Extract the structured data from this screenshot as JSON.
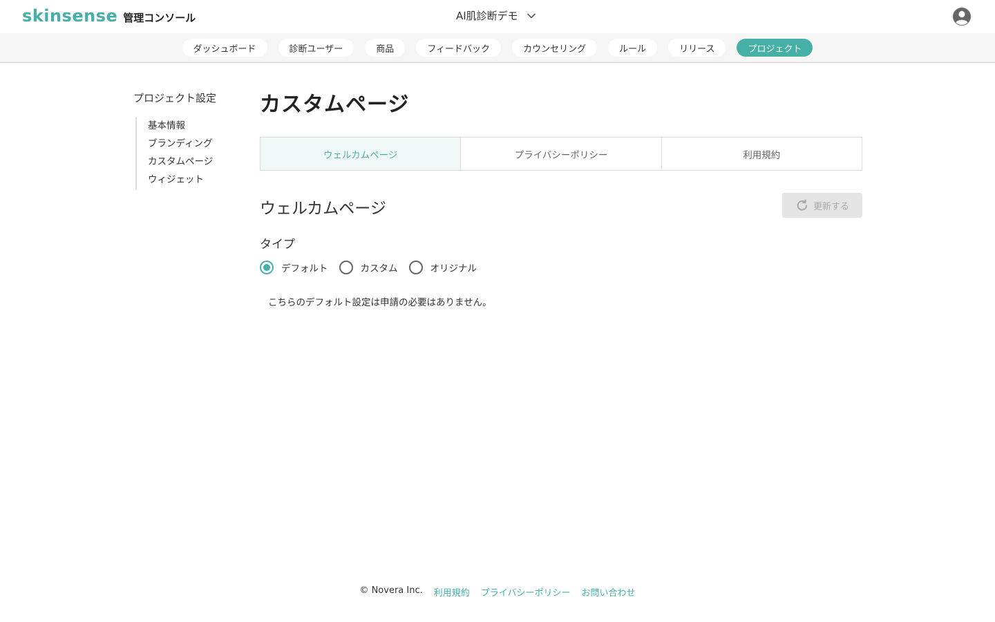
{
  "header": {
    "brand": "skinsense",
    "console_label": "管理コンソール",
    "project_name": "AI肌診断デモ",
    "icons": {
      "chevron": "chevron-down-icon",
      "avatar": "user-avatar-icon"
    }
  },
  "nav": {
    "items": [
      {
        "label": "ダッシュボード",
        "active": false
      },
      {
        "label": "診断ユーザー",
        "active": false
      },
      {
        "label": "商品",
        "active": false
      },
      {
        "label": "フィードバック",
        "active": false
      },
      {
        "label": "カウンセリング",
        "active": false
      },
      {
        "label": "ルール",
        "active": false
      },
      {
        "label": "リリース",
        "active": false
      },
      {
        "label": "プロジェクト",
        "active": true
      }
    ]
  },
  "sidebar": {
    "title": "プロジェクト設定",
    "items": [
      {
        "label": "基本情報"
      },
      {
        "label": "ブランディング"
      },
      {
        "label": "カスタムページ"
      },
      {
        "label": "ウィジェット"
      }
    ]
  },
  "main": {
    "title": "カスタムページ",
    "tabs": [
      {
        "label": "ウェルカムページ",
        "active": true
      },
      {
        "label": "プライバシーポリシー",
        "active": false
      },
      {
        "label": "利用規約",
        "active": false
      }
    ],
    "section_title": "ウェルカムページ",
    "update_button": {
      "label": "更新する",
      "icon": "refresh-icon",
      "disabled": true
    },
    "type_label": "タイプ",
    "type_options": [
      {
        "label": "デフォルト",
        "checked": true
      },
      {
        "label": "カスタム",
        "checked": false
      },
      {
        "label": "オリジナル",
        "checked": false
      }
    ],
    "note": "こちらのデフォルト設定は申請の必要はありません。"
  },
  "footer": {
    "copyright": "© Novera Inc.",
    "links": [
      {
        "label": "利用規約"
      },
      {
        "label": "プライバシーポリシー"
      },
      {
        "label": "お問い合わせ"
      }
    ]
  },
  "colors": {
    "accent": "#46b0a6",
    "nav_bg": "#f5f5f5",
    "disabled_bg": "#e4e4e4"
  }
}
